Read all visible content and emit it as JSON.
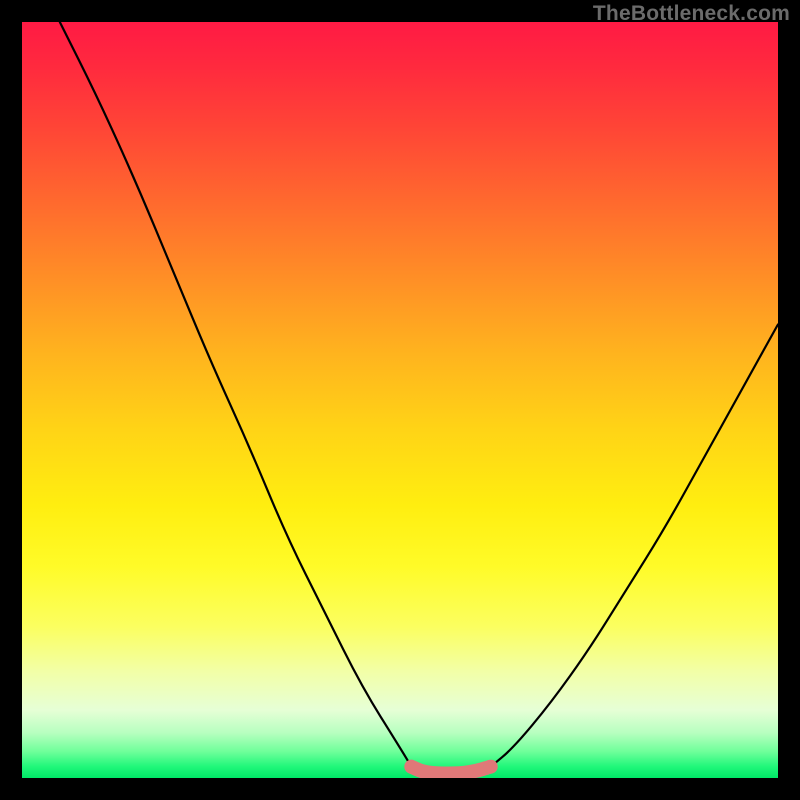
{
  "watermark": "TheBottleneck.com",
  "chart_data": {
    "type": "line",
    "title": "",
    "xlabel": "",
    "ylabel": "",
    "xlim": [
      0,
      100
    ],
    "ylim": [
      0,
      100
    ],
    "series": [
      {
        "name": "left-curve",
        "x": [
          5,
          10,
          15,
          20,
          25,
          30,
          35,
          40,
          45,
          50,
          51.5
        ],
        "values": [
          100,
          90,
          79,
          67,
          55,
          44,
          32,
          22,
          12,
          4,
          1.5
        ]
      },
      {
        "name": "right-curve",
        "x": [
          62,
          65,
          70,
          75,
          80,
          85,
          90,
          95,
          100
        ],
        "values": [
          1.5,
          4,
          10,
          17,
          25,
          33,
          42,
          51,
          60
        ]
      },
      {
        "name": "bottom-bridge",
        "x": [
          51.5,
          53,
          55,
          58,
          60,
          62
        ],
        "values": [
          1.5,
          0.8,
          0.6,
          0.6,
          0.9,
          1.5
        ]
      }
    ],
    "annotations": [
      {
        "name": "watermark",
        "text": "TheBottleneck.com"
      }
    ],
    "colors": {
      "curve": "#000000",
      "bridge": "#e07878",
      "gradient_top": "#ff1a44",
      "gradient_mid": "#ffee10",
      "gradient_bottom": "#00e867"
    }
  }
}
